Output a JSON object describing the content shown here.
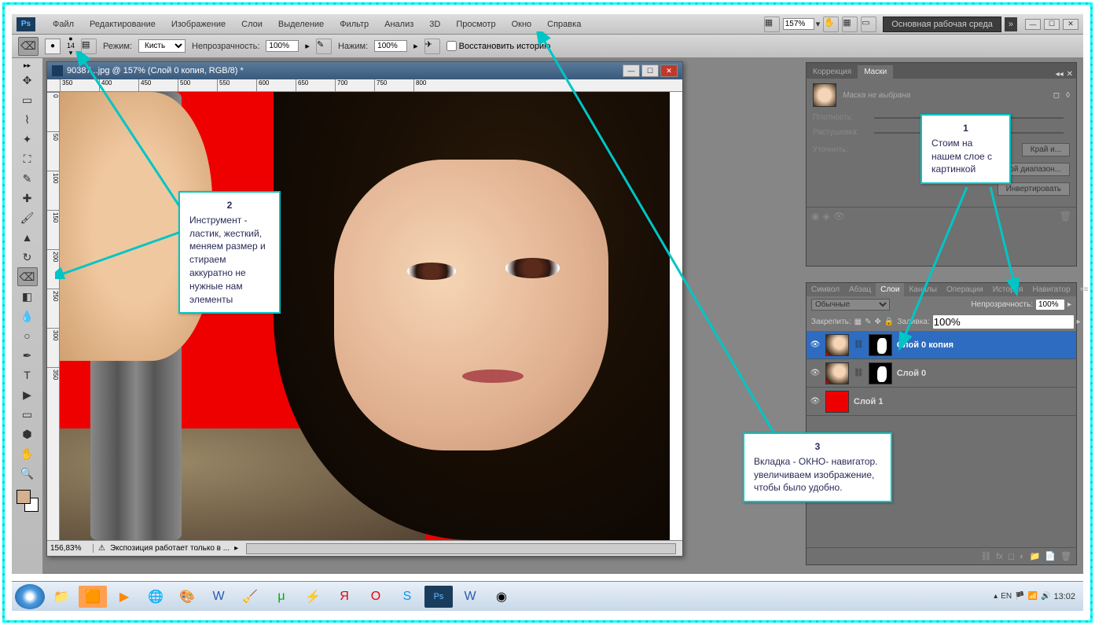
{
  "menubar": {
    "items": [
      "Файл",
      "Редактирование",
      "Изображение",
      "Слои",
      "Выделение",
      "Фильтр",
      "Анализ",
      "3D",
      "Просмотр",
      "Окно",
      "Справка"
    ],
    "zoom": "157%",
    "workspace": "Основная рабочая среда"
  },
  "optbar": {
    "brush_size": "14",
    "mode_label": "Режим:",
    "mode_value": "Кисть",
    "opacity_label": "Непрозрачность:",
    "opacity_value": "100%",
    "flow_label": "Нажим:",
    "flow_value": "100%",
    "history_label": "Восстановить историю"
  },
  "doc": {
    "title": "90387...jpg @ 157% (Слой 0 копия, RGB/8) *",
    "zoom": "156,83%",
    "status": "Экспозиция работает только в ...",
    "ruler_h": [
      "350",
      "400",
      "450",
      "500",
      "550",
      "600",
      "650",
      "700",
      "750",
      "800"
    ],
    "ruler_v": [
      "0",
      "50",
      "100",
      "150",
      "200",
      "250",
      "300",
      "350"
    ]
  },
  "masks": {
    "tab_corr": "Коррекция",
    "tab_masks": "Маски",
    "no_mask": "Маска не выбрана",
    "density": "Плотность:",
    "feather": "Растушевка:",
    "refine": "Уточнить:",
    "edge_btn": "Край и...",
    "color_btn": "Цветовой диапазон...",
    "invert_btn": "Инвертировать"
  },
  "layers": {
    "tabs": [
      "Символ",
      "Абзац",
      "Слои",
      "Каналы",
      "Операции",
      "История",
      "Навигатор"
    ],
    "active_tab": 2,
    "blend_mode": "Обычные",
    "opacity_label": "Непрозрачность:",
    "opacity": "100%",
    "lock_label": "Закрепить:",
    "fill_label": "Заливка:",
    "fill": "100%",
    "items": [
      {
        "name": "Слой 0 копия",
        "selected": true,
        "hasmask": true
      },
      {
        "name": "Слой 0",
        "selected": false,
        "hasmask": true
      },
      {
        "name": "Слой 1",
        "selected": false,
        "red": true
      }
    ]
  },
  "callouts": {
    "c1": {
      "num": "1",
      "text": "Стоим на нашем слое с картинкой"
    },
    "c2": {
      "num": "2",
      "text": "Инструмент - ластик, жесткий, меняем размер и стираем аккуратно не нужные нам элементы"
    },
    "c3": {
      "num": "3",
      "text": "Вкладка - ОКНО- навигатор. увеличиваем изображение, чтобы было удобно."
    }
  },
  "taskbar": {
    "lang": "EN",
    "time": "13:02"
  }
}
